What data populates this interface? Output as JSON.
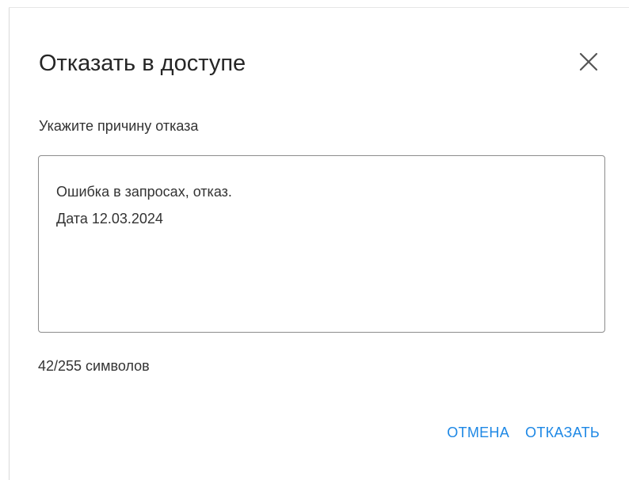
{
  "dialog": {
    "title": "Отказать в доступе",
    "close_icon": "close-icon",
    "field_label": "Укажите причину отказа",
    "reason_lines": [
      "Ошибка в запросах, отказ.",
      "Дата 12.03.2024"
    ],
    "counter": "42/255 символов",
    "cancel_label": "ОТМЕНА",
    "deny_label": "ОТКАЗАТЬ"
  },
  "colors": {
    "accent": "#1e88e5",
    "text": "#333333",
    "title": "#262626",
    "border": "#8c8c8c"
  }
}
